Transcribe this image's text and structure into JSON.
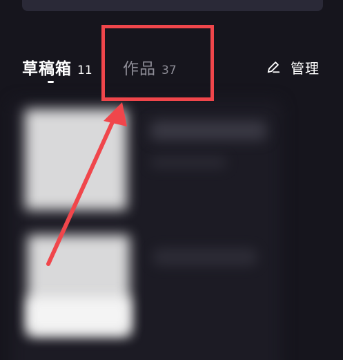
{
  "tabs": {
    "drafts": {
      "label": "草稿箱",
      "count": "11"
    },
    "works": {
      "label": "作品",
      "count": "37"
    }
  },
  "toolbar": {
    "manage_label": "管理",
    "manage_icon": "edit-pencil-icon"
  },
  "colors": {
    "background": "#16151d",
    "active_text": "#ffffff",
    "inactive_text": "#8e8d97",
    "annotation": "#f0464b"
  }
}
